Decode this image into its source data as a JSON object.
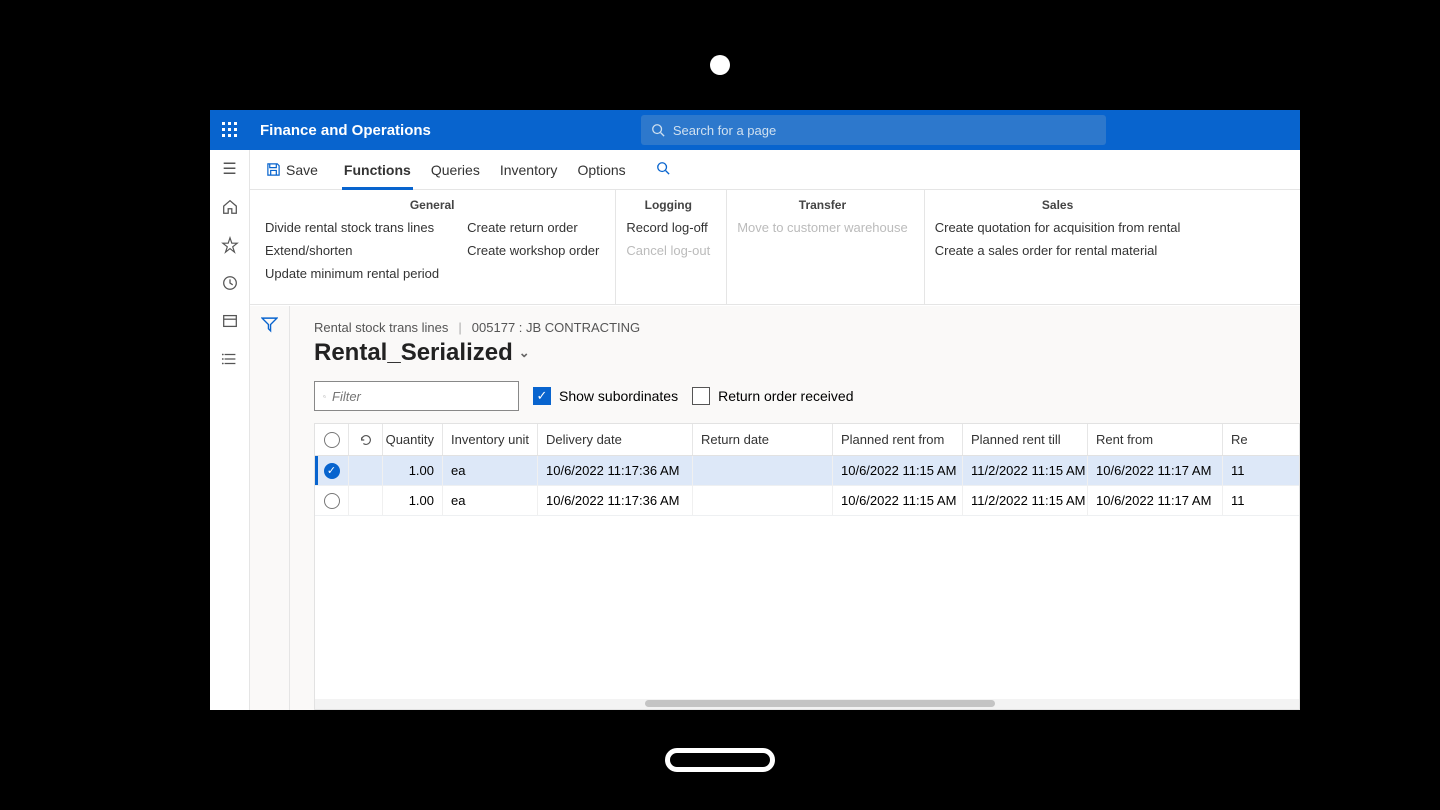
{
  "topbar": {
    "app_title": "Finance and Operations",
    "search_placeholder": "Search for a page"
  },
  "actionbar": {
    "save_label": "Save",
    "tabs": [
      "Functions",
      "Queries",
      "Inventory",
      "Options"
    ],
    "active_tab": 0
  },
  "ribbon": {
    "general": {
      "header": "General",
      "col1": [
        "Divide rental stock trans lines",
        "Extend/shorten",
        "Update minimum rental period"
      ],
      "col2": [
        "Create return order",
        "Create workshop order"
      ]
    },
    "logging": {
      "header": "Logging",
      "items": [
        {
          "label": "Record log-off",
          "disabled": false
        },
        {
          "label": "Cancel log-out",
          "disabled": true
        }
      ]
    },
    "transfer": {
      "header": "Transfer",
      "items": [
        {
          "label": "Move to customer warehouse",
          "disabled": true
        }
      ]
    },
    "sales": {
      "header": "Sales",
      "items": [
        "Create quotation for acquisition from rental",
        "Create a sales order for rental material"
      ]
    }
  },
  "breadcrumb": {
    "part1": "Rental stock trans lines",
    "part2": "005177 : JB CONTRACTING"
  },
  "page_title": "Rental_Serialized",
  "filters": {
    "placeholder": "Filter",
    "show_subordinates_label": "Show subordinates",
    "show_subordinates_checked": true,
    "return_order_label": "Return order received",
    "return_order_checked": false
  },
  "grid": {
    "columns": [
      "Quantity",
      "Inventory unit",
      "Delivery date",
      "Return date",
      "Planned rent from",
      "Planned rent till",
      "Rent from",
      "Re"
    ],
    "rows": [
      {
        "selected": true,
        "quantity": "1.00",
        "unit": "ea",
        "delivery": "10/6/2022 11:17:36 AM",
        "return": "",
        "pfrom": "10/6/2022 11:15 AM",
        "ptill": "11/2/2022 11:15 AM",
        "rfrom": "10/6/2022 11:17 AM",
        "last": "11"
      },
      {
        "selected": false,
        "quantity": "1.00",
        "unit": "ea",
        "delivery": "10/6/2022 11:17:36 AM",
        "return": "",
        "pfrom": "10/6/2022 11:15 AM",
        "ptill": "11/2/2022 11:15 AM",
        "rfrom": "10/6/2022 11:17 AM",
        "last": "11"
      }
    ]
  }
}
